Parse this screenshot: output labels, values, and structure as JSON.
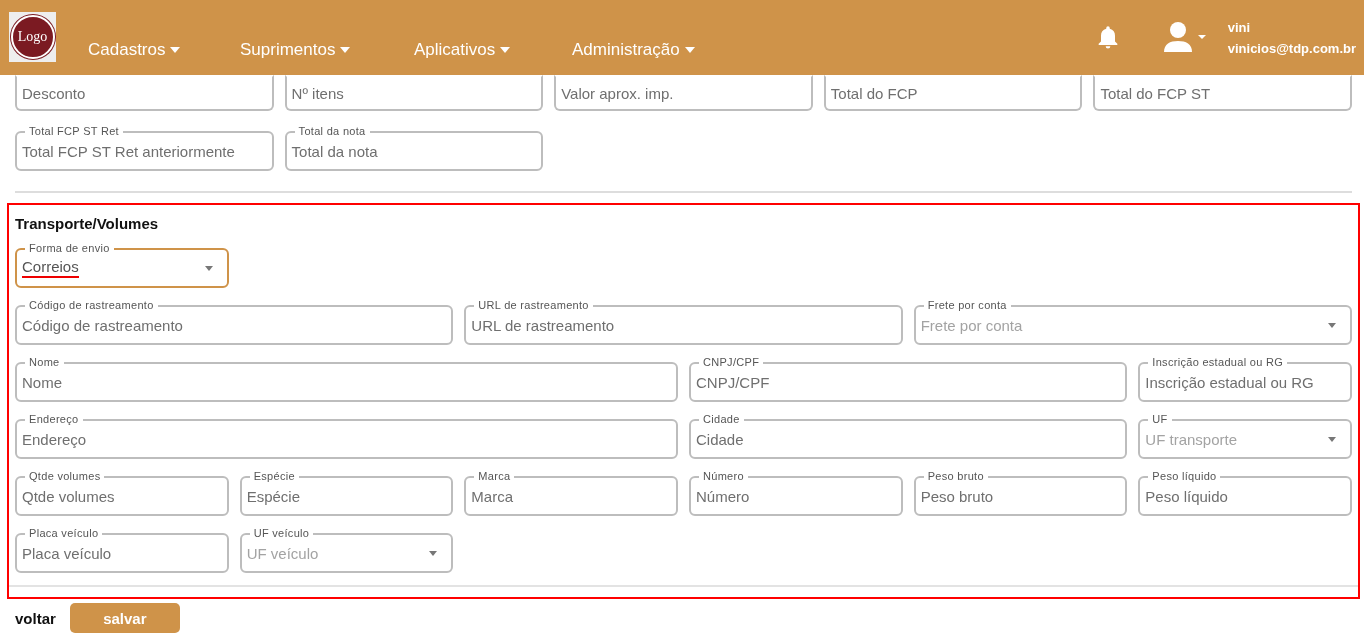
{
  "header": {
    "logo": "Logo",
    "nav": [
      {
        "label": "Cadastros"
      },
      {
        "label": "Suprimentos"
      },
      {
        "label": "Aplicativos"
      },
      {
        "label": "Administração"
      }
    ],
    "user": {
      "name": "vini",
      "email": "vinicios@tdp.com.br"
    }
  },
  "totals": {
    "rows": [
      {
        "fields": [
          {
            "kind": "text",
            "placeholder": "Desconto"
          },
          {
            "kind": "text",
            "placeholder": "Nº itens"
          },
          {
            "kind": "text",
            "placeholder": "Valor aprox. imp."
          },
          {
            "kind": "text",
            "placeholder": "Total do FCP"
          },
          {
            "kind": "text",
            "placeholder": "Total do FCP ST"
          }
        ]
      },
      {
        "fields": [
          {
            "kind": "text",
            "label": "Total FCP ST Ret",
            "placeholder": "Total FCP ST Ret anteriormente"
          },
          {
            "kind": "text",
            "label": "Total da nota",
            "placeholder": "Total da nota"
          }
        ]
      }
    ]
  },
  "transport": {
    "title": "Transporte/Volumes",
    "rows": [
      {
        "fields": [
          {
            "kind": "select",
            "label": "Forma de envio",
            "value": "Correios",
            "focused": true
          }
        ]
      },
      {
        "fields": [
          {
            "kind": "text",
            "label": "Código de rastreamento",
            "placeholder": "Código de rastreamento"
          },
          {
            "kind": "text",
            "label": "URL de rastreamento",
            "placeholder": "URL de rastreamento"
          },
          {
            "kind": "select",
            "label": "Frete por conta",
            "placeholder": "Frete por conta"
          }
        ]
      },
      {
        "fields": [
          {
            "kind": "text",
            "label": "Nome",
            "placeholder": "Nome"
          },
          {
            "kind": "text",
            "label": "CNPJ/CPF",
            "placeholder": "CNPJ/CPF"
          },
          {
            "kind": "text",
            "label": "Inscrição estadual ou RG",
            "placeholder": "Inscrição estadual ou RG"
          }
        ]
      },
      {
        "fields": [
          {
            "kind": "text",
            "label": "Endereço",
            "placeholder": "Endereço"
          },
          {
            "kind": "text",
            "label": "Cidade",
            "placeholder": "Cidade"
          },
          {
            "kind": "select",
            "label": "UF",
            "placeholder": "UF transporte"
          }
        ]
      },
      {
        "fields": [
          {
            "kind": "text",
            "label": "Qtde volumes",
            "placeholder": "Qtde volumes"
          },
          {
            "kind": "text",
            "label": "Espécie",
            "placeholder": "Espécie"
          },
          {
            "kind": "text",
            "label": "Marca",
            "placeholder": "Marca"
          },
          {
            "kind": "text",
            "label": "Número",
            "placeholder": "Número"
          },
          {
            "kind": "text",
            "label": "Peso bruto",
            "placeholder": "Peso bruto"
          },
          {
            "kind": "text",
            "label": "Peso líquido",
            "placeholder": "Peso líquido"
          }
        ]
      },
      {
        "fields": [
          {
            "kind": "text",
            "label": "Placa veículo",
            "placeholder": "Placa veículo"
          },
          {
            "kind": "select",
            "label": "UF veículo",
            "placeholder": "UF veículo"
          }
        ]
      }
    ]
  },
  "actions": {
    "back": "voltar",
    "save": "salvar"
  }
}
